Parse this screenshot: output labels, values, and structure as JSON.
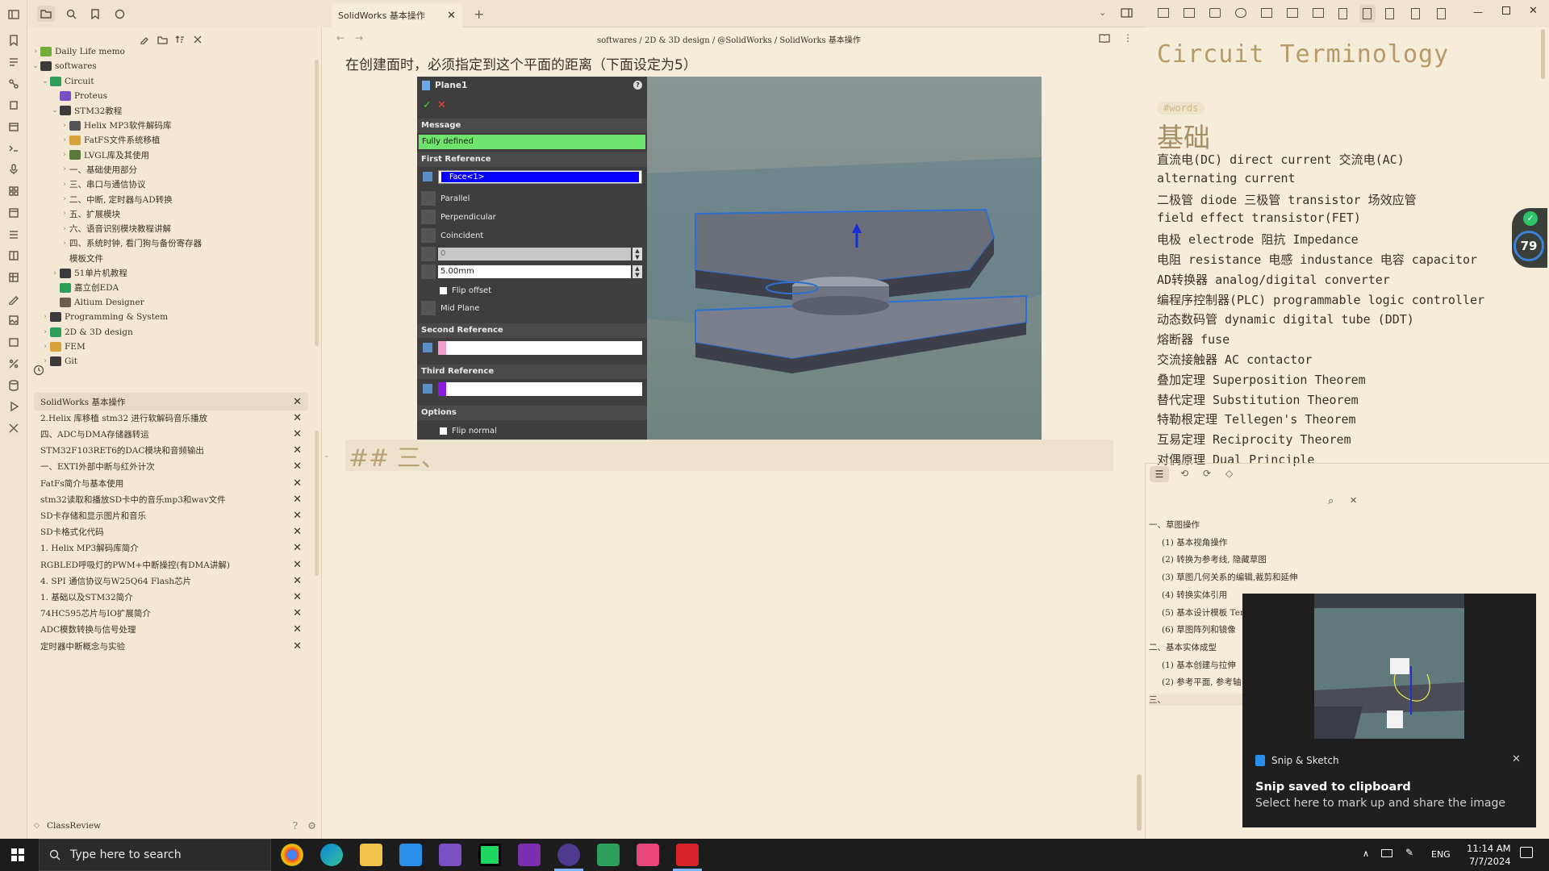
{
  "editor_tab": {
    "title": "SolidWorks 基本操作"
  },
  "breadcrumb": [
    "softwares",
    "2D & 3D design",
    "@SolidWorks",
    "SolidWorks 基本操作"
  ],
  "paragraph": "在创建面时，必须指定到这个平面的距离（下面设定为5）",
  "file_tree": [
    {
      "label": "Daily Life memo",
      "caret": "›"
    },
    {
      "label": "softwares",
      "caret": "⌄"
    },
    {
      "label": "Circuit",
      "caret": "⌄"
    },
    {
      "label": "Proteus",
      "caret": ""
    },
    {
      "label": "STM32教程",
      "caret": "⌄"
    },
    {
      "label": "Helix MP3软件解码库",
      "caret": "›"
    },
    {
      "label": "FatFS文件系统移植",
      "caret": "›"
    },
    {
      "label": "LVGL库及其使用",
      "caret": "›"
    },
    {
      "label": "一、基础使用部分",
      "caret": "›"
    },
    {
      "label": "三、串口与通信协议",
      "caret": "›"
    },
    {
      "label": "二、中断, 定时器与AD转换",
      "caret": "›"
    },
    {
      "label": "五、扩展模块",
      "caret": "›"
    },
    {
      "label": "六、语音识别模块教程讲解",
      "caret": "›"
    },
    {
      "label": "四、系统时钟, 看门狗与备份寄存器",
      "caret": "›"
    },
    {
      "label": "模板文件",
      "caret": ""
    },
    {
      "label": "51单片机教程",
      "caret": "›"
    },
    {
      "label": "嘉立创EDA",
      "caret": ""
    },
    {
      "label": "Altium Designer",
      "caret": ""
    },
    {
      "label": "Programming & System",
      "caret": "›"
    },
    {
      "label": "2D & 3D design",
      "caret": "›"
    },
    {
      "label": "FEM",
      "caret": "›"
    },
    {
      "label": "Git",
      "caret": "›"
    }
  ],
  "recent_tabs": [
    "SolidWorks 基本操作",
    "2.Helix 库移植 stm32 进行软解码音乐播放",
    "四、ADC与DMA存储器转运",
    "STM32F103RET6的DAC模块和音频输出",
    "一、EXTI外部中断与红外计次",
    "FatFs简介与基本使用",
    "stm32读取和播放SD卡中的音乐mp3和wav文件",
    "SD卡存储和显示图片和音乐",
    "SD卡格式化代码",
    "1. Helix MP3解码库简介",
    "RGBLED呼吸灯的PWM+中断操控(有DMA讲解)",
    "4. SPI 通信协议与W25Q64 Flash芯片",
    "1. 基础以及STM32简介",
    "74HC595芯片与IO扩展简介",
    "ADC模数转换与信号处理",
    "定时器中断概念与实验"
  ],
  "vault_name": "ClassReview",
  "sw_panel": {
    "title": "Plane1",
    "message_header": "Message",
    "message": "Fully defined",
    "first_ref_header": "First Reference",
    "first_ref_value": "Face<1>",
    "options": [
      "Parallel",
      "Perpendicular",
      "Coincident"
    ],
    "angle_value": "0",
    "distance_value": "5.00mm",
    "flip_offset": "Flip offset",
    "mid_plane": "Mid Plane",
    "second_ref_header": "Second Reference",
    "third_ref_header": "Third Reference",
    "options_header": "Options",
    "flip_normal": "Flip normal"
  },
  "heading": "## 三、",
  "right_note": {
    "title": "Circuit Terminology",
    "tag": "#words",
    "heading": "基础",
    "lines": [
      "直流电(DC) direct current 交流电(AC)",
      "alternating current",
      "二极管 diode    三极管 transistor  场效应管",
      "field effect transistor(FET)",
      "电极 electrode  阻抗 Impedance",
      "电阻 resistance 电感 industance 电容 capacitor",
      "AD转换器 analog/digital converter",
      "编程序控制器(PLC) programmable logic controller",
      "动态数码管 dynamic digital tube (DDT)",
      "熔断器 fuse",
      "交流接触器 AC contactor",
      "叠加定理 Superposition Theorem",
      "替代定理 Substitution Theorem",
      "特勒根定理 Tellegen's Theorem",
      "互易定理 Reciprocity Theorem",
      "对偶原理 Dual Principle"
    ]
  },
  "outline": [
    "一、草图操作",
    "(1) 基本视角操作",
    "(2) 转换为参考线, 隐藏草图",
    "(3) 草图几何关系的编辑,裁剪和延伸",
    "(4) 转换实体引用",
    "(5) 基本设计模板 Ter",
    "(6) 草图阵列和镜像",
    "二、基本实体成型",
    "(1) 基本创建与拉伸",
    "(2) 参考平面, 参考轴",
    "三、"
  ],
  "badge_value": "79",
  "snip": {
    "app": "Snip & Sketch",
    "title": "Snip saved to clipboard",
    "subtitle": "Select here to mark up and share the image"
  },
  "taskbar": {
    "search_placeholder": "Type here to search",
    "lang": "ENG",
    "time": "11:14 AM",
    "date": "7/7/2024"
  },
  "colors": {
    "accent": "#b89968",
    "sw_green": "#6fe36b",
    "sw_select": "#0a00ff"
  }
}
